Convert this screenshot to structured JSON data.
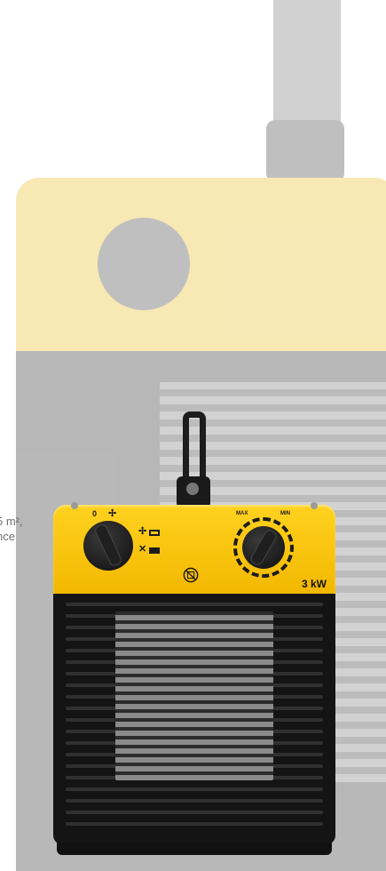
{
  "caption": {
    "line1": "5 m²,",
    "line2": "nce"
  },
  "heater": {
    "power_label": "3 kW",
    "mode_marks": {
      "off": "0",
      "fan": "✢",
      "heat": "✕"
    },
    "thermostat_marks": {
      "max": "MAX",
      "min": "MIN"
    },
    "brand_color": "#f5bd00",
    "body_color": "#141414",
    "icons": [
      "do-not-cover-icon",
      "fan-symbol-icon",
      "heat-symbol-icon"
    ]
  }
}
